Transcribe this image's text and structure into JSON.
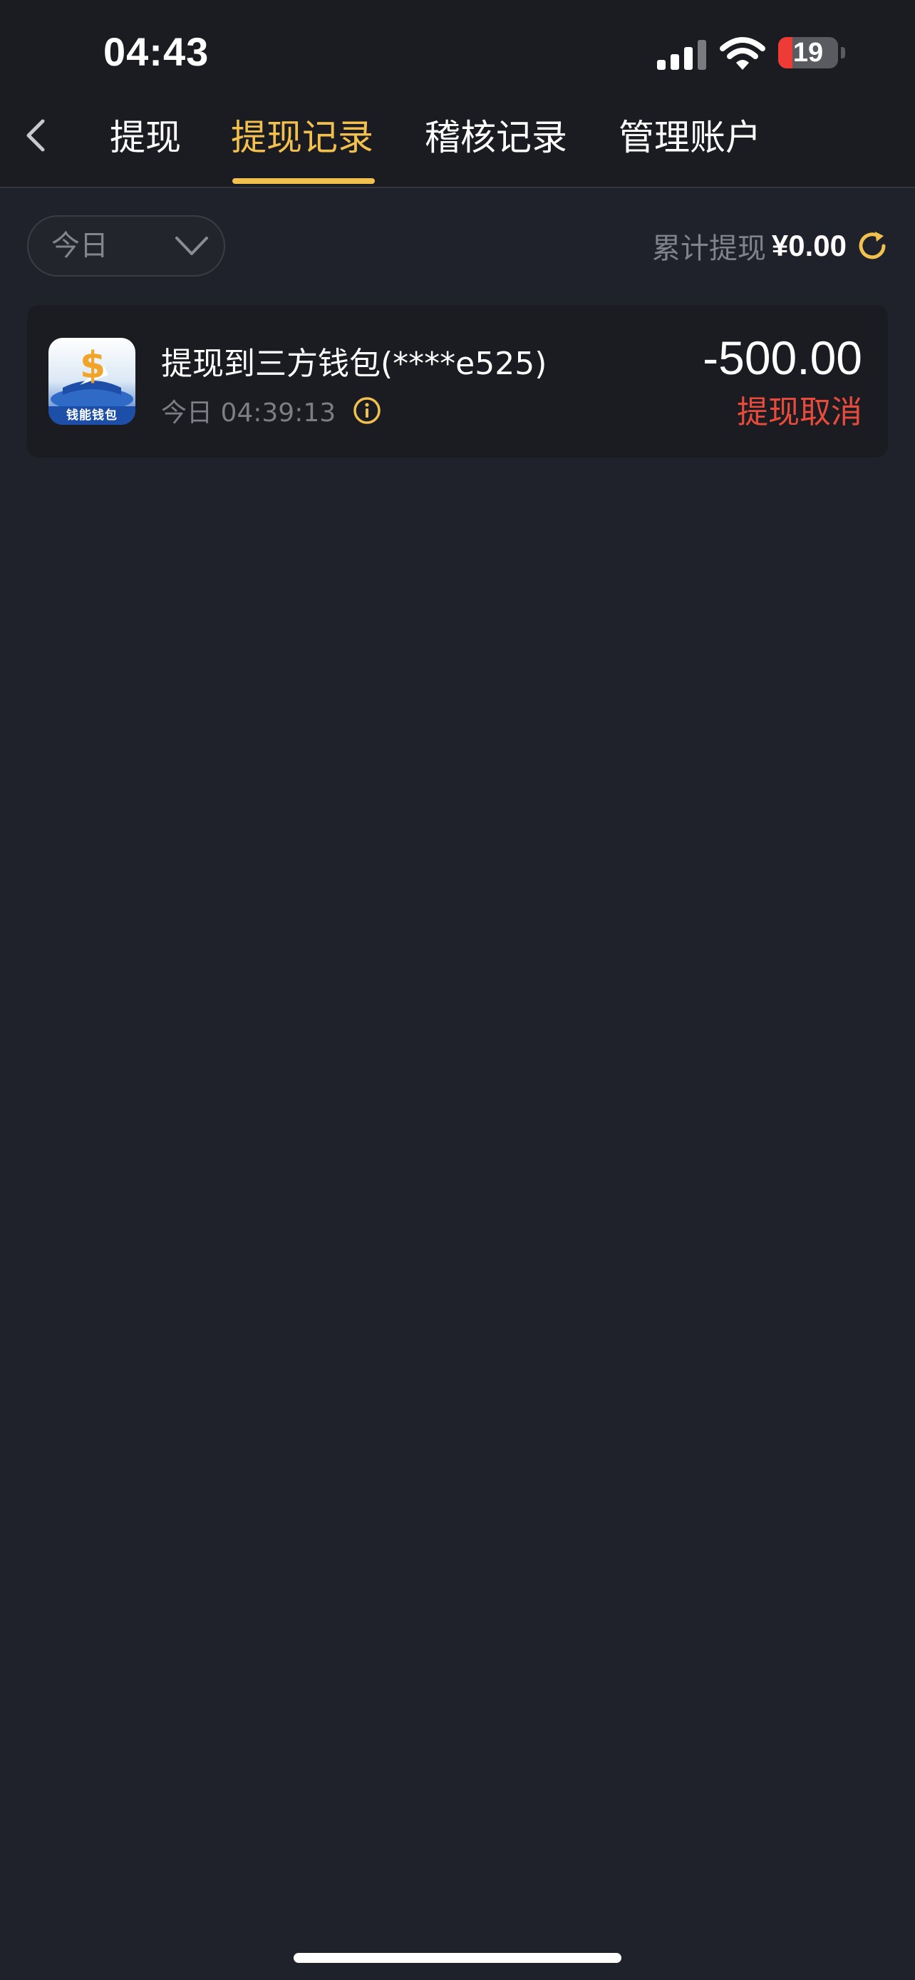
{
  "status_bar": {
    "time": "04:43",
    "battery": "19"
  },
  "header": {
    "tabs": [
      {
        "label": "提现",
        "active": false
      },
      {
        "label": "提现记录",
        "active": true
      },
      {
        "label": "稽核记录",
        "active": false
      },
      {
        "label": "管理账户",
        "active": false
      }
    ]
  },
  "filter": {
    "date_selected": "今日",
    "total_label": "累计提现",
    "total_value": "¥0.00"
  },
  "records": [
    {
      "app_icon_text": "钱能钱包",
      "title": "提现到三方钱包(****e525)",
      "time": "今日 04:39:13",
      "amount": "-500.00",
      "status": "提现取消"
    }
  ],
  "colors": {
    "accent": "#f2c04f",
    "status_cancel": "#e84b3c",
    "background": "#20222b",
    "card": "#1b1c22"
  },
  "icons": [
    "back-arrow-icon",
    "chevron-down-icon",
    "refresh-icon",
    "info-icon",
    "cellular-signal-icon",
    "wifi-icon",
    "battery-icon"
  ]
}
